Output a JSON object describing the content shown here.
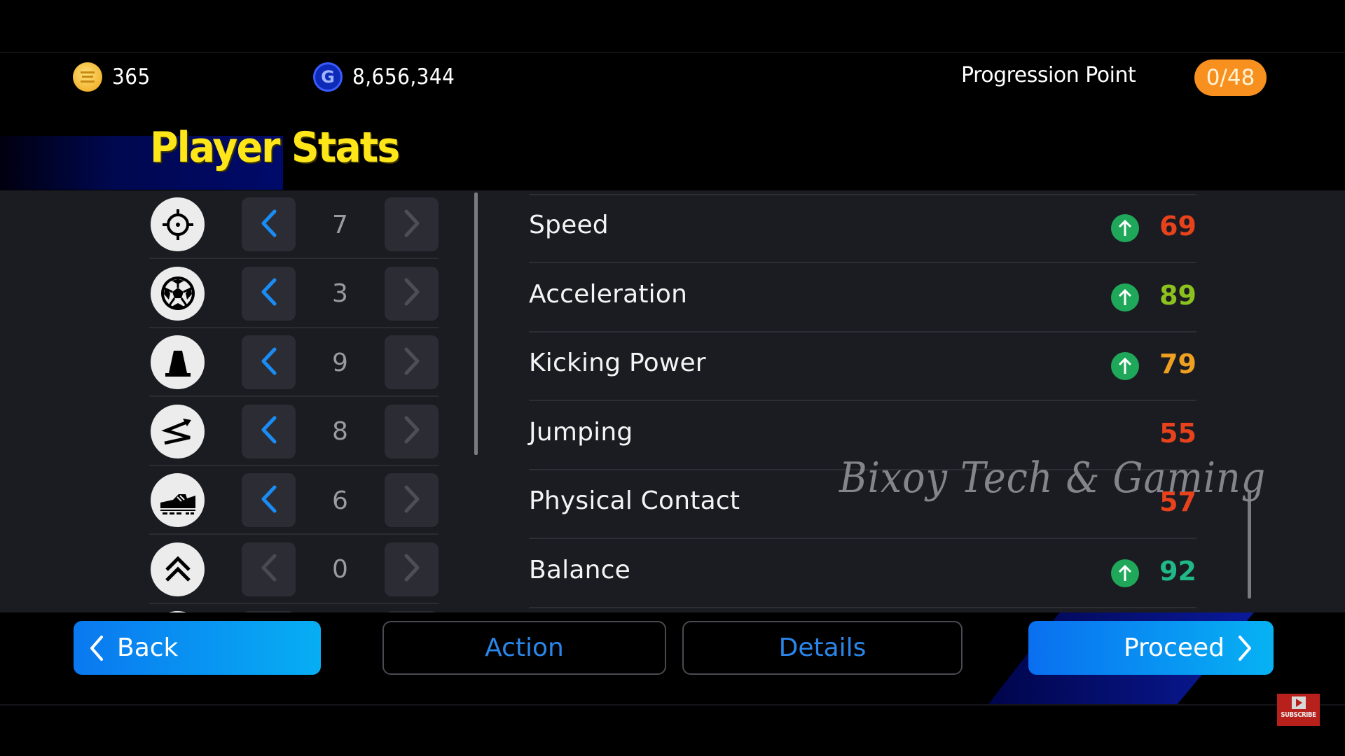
{
  "header": {
    "currencies": [
      {
        "name": "ecoin",
        "icon": "gold-coin-icon",
        "value": "365"
      },
      {
        "name": "gp",
        "icon": "gp-coin-icon",
        "letter": "G",
        "value": "8,656,344"
      }
    ],
    "progression": {
      "label": "Progression Point",
      "value": "0/48",
      "badge_color": "#f7901e"
    }
  },
  "title": "Player Stats",
  "categories": [
    {
      "icon": "crosshair-icon",
      "level": "7",
      "decrease_enabled": true,
      "increase_enabled": false
    },
    {
      "icon": "soccer-ball-icon",
      "level": "3",
      "decrease_enabled": true,
      "increase_enabled": false
    },
    {
      "icon": "training-cone-icon",
      "level": "9",
      "decrease_enabled": true,
      "increase_enabled": false
    },
    {
      "icon": "zigzag-arrow-icon",
      "level": "8",
      "decrease_enabled": true,
      "increase_enabled": false
    },
    {
      "icon": "football-boot-icon",
      "level": "6",
      "decrease_enabled": true,
      "increase_enabled": false
    },
    {
      "icon": "double-chevron-up-icon",
      "level": "0",
      "decrease_enabled": false,
      "increase_enabled": false
    }
  ],
  "stats": [
    {
      "label": "Speed",
      "value": "69",
      "boosted": true,
      "color": "#e8421c"
    },
    {
      "label": "Acceleration",
      "value": "89",
      "boosted": true,
      "color": "#8cc21e"
    },
    {
      "label": "Kicking Power",
      "value": "79",
      "boosted": true,
      "color": "#f0a020"
    },
    {
      "label": "Jumping",
      "value": "55",
      "boosted": false,
      "color": "#e8421c"
    },
    {
      "label": "Physical Contact",
      "value": "57",
      "boosted": false,
      "color": "#e8421c"
    },
    {
      "label": "Balance",
      "value": "92",
      "boosted": true,
      "color": "#1fb886"
    }
  ],
  "watermark": "Bixoy Tech & Gaming",
  "footer": {
    "back": "Back",
    "action": "Action",
    "details": "Details",
    "proceed": "Proceed"
  },
  "subscribe_badge": "SUBSCRIBE",
  "colors": {
    "accent_blue": "#0a86f0",
    "panel_bg": "#1b1c22",
    "title_yellow": "#ffe619",
    "boost_green": "#20a85a"
  }
}
